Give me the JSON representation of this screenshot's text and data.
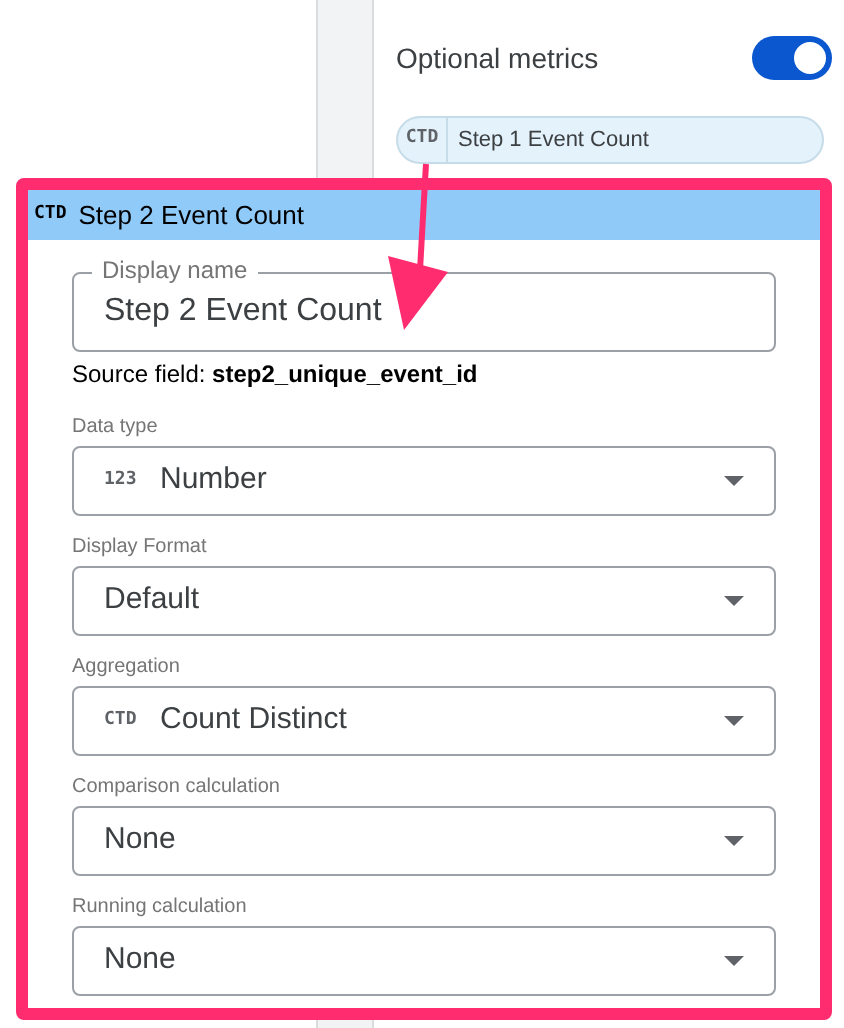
{
  "side_panel": {
    "optional_metrics": {
      "label": "Optional metrics",
      "on": true
    },
    "metric_chip": {
      "icon": "CTD",
      "label": "Step 1 Event Count"
    }
  },
  "editor": {
    "header": {
      "icon": "CTD",
      "title": "Step 2 Event Count"
    },
    "display_name": {
      "label": "Display name",
      "value": "Step 2 Event Count"
    },
    "source_field": "Source field: **step2_unique_event_id**",
    "fields": [
      {
        "label": "Data type",
        "icon": "123",
        "value": "Number"
      },
      {
        "label": "Display Format",
        "value": "Default"
      },
      {
        "label": "Aggregation",
        "icon": "CTD",
        "value": "Count Distinct"
      },
      {
        "label": "Comparison calculation",
        "value": "None"
      },
      {
        "label": "Running calculation",
        "value": "None"
      }
    ]
  }
}
